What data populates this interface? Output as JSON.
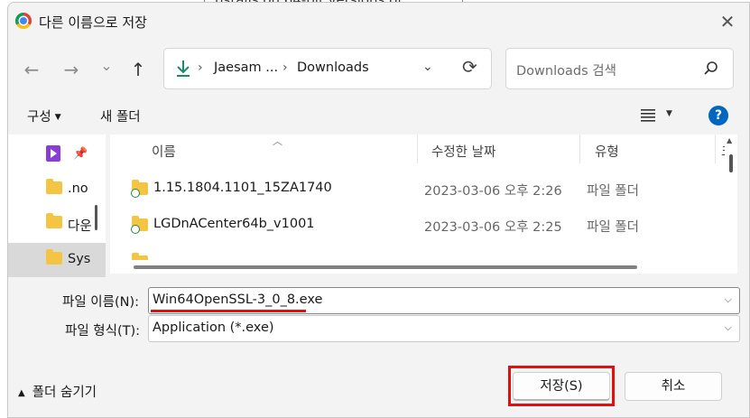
{
  "background": {
    "peek_text": "nstalls on 64-bit versions of"
  },
  "dialog": {
    "title": "다른 이름으로 저장",
    "close_glyph": "✕"
  },
  "nav": {
    "back_glyph": "←",
    "forward_glyph": "→",
    "recent_glyph": "⌄",
    "up_glyph": "↑",
    "breadcrumb": [
      "Jaesam ...",
      "Downloads"
    ],
    "breadcrumb_sep": "›",
    "dropdown_glyph": "⌄",
    "refresh_glyph": "⟳",
    "search_placeholder": "Downloads 검색"
  },
  "toolbar": {
    "organize_label": "구성",
    "new_folder_label": "새 폴더",
    "help_glyph": "?"
  },
  "sidebar": {
    "items": [
      {
        "label": "",
        "icon": "video-icon",
        "pinned": true
      },
      {
        "label": ".no",
        "icon": "folder-icon"
      },
      {
        "label": "다운",
        "icon": "download-folder-icon"
      },
      {
        "label": "Sys",
        "icon": "folder-icon",
        "selected": true
      }
    ]
  },
  "file_list": {
    "columns": [
      "이름",
      "수정한 날짜",
      "유형",
      "크"
    ],
    "rows": [
      {
        "name": "1.15.1804.1101_15ZA1740",
        "date": "2023-03-06 오후 2:26",
        "type": "파일 폴더"
      },
      {
        "name": "LGDnACenter64b_v1001",
        "date": "2023-03-06 오후 2:25",
        "type": "파일 폴더"
      },
      {
        "name": "",
        "date": "",
        "type": ""
      }
    ]
  },
  "form": {
    "filename_label": "파일 이름(N):",
    "filename_value": "Win64OpenSSL-3_0_8.exe",
    "filetype_label": "파일 형식(T):",
    "filetype_value": "Application (*.exe)"
  },
  "footer": {
    "hide_folders_label": "폴더 숨기기",
    "save_label": "저장(S)",
    "cancel_label": "취소"
  },
  "colors": {
    "highlight_red": "#e01010",
    "help_blue": "#0067c0",
    "folder_yellow": "#f4c542"
  }
}
